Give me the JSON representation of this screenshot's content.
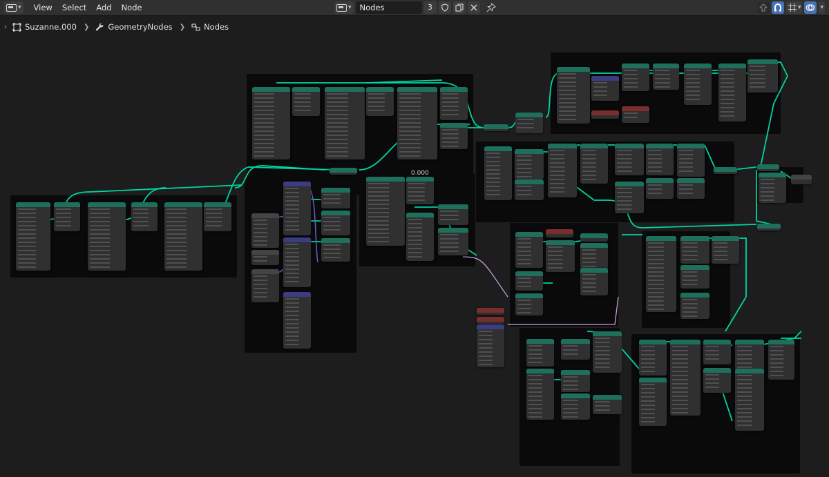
{
  "header": {
    "menu": [
      "View",
      "Select",
      "Add",
      "Node"
    ],
    "node_tree_name": "Nodes",
    "users_count": "3"
  },
  "breadcrumb": {
    "object": "Suzanne.000",
    "modifier": "GeometryNodes",
    "node_tree": "Nodes"
  },
  "canvas": {
    "value_label": "0.000"
  },
  "colors": {
    "geometry_link": "#00d6a3",
    "vector_link": "#6363c7",
    "field_link": "#c7a3e0",
    "geometry_node_header": "#1e6f5c",
    "input_node_header": "#7a2d2d",
    "utility_node_header": "#3c3c83"
  }
}
